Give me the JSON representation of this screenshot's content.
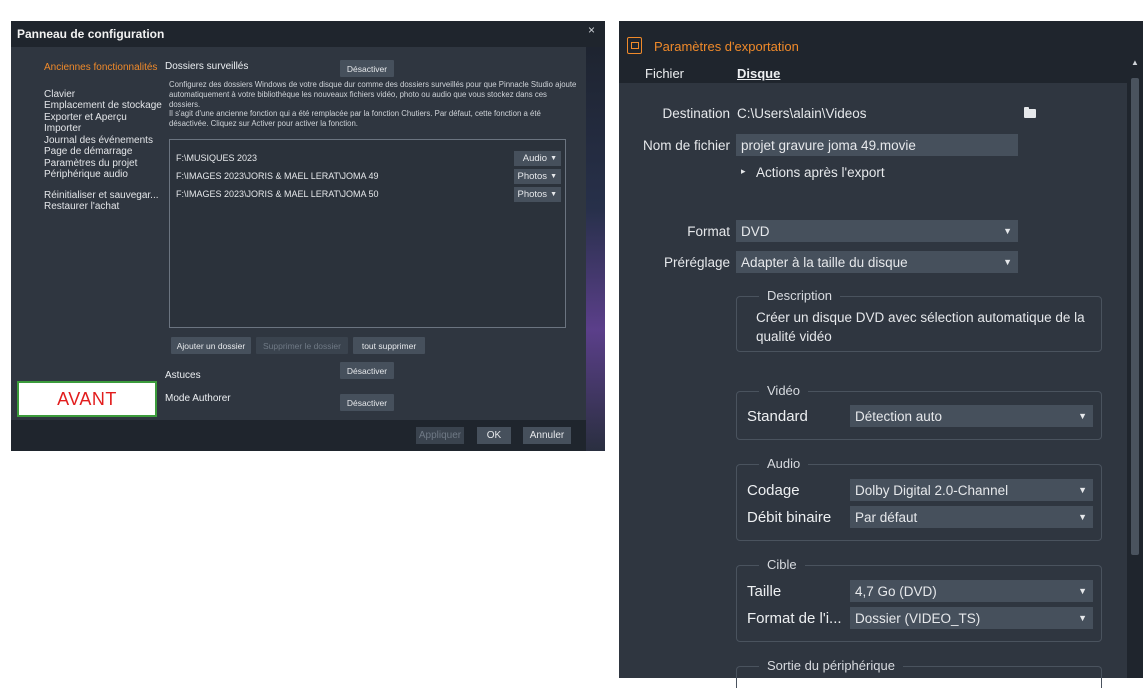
{
  "control_panel": {
    "title": "Panneau de configuration",
    "close_glyph": "×",
    "nav": {
      "active": "Anciennes fonctionnalités",
      "items": [
        "Clavier",
        "Emplacement de stockage",
        "Exporter et Aperçu",
        "Importer",
        "Journal des événements",
        "Page de démarrage",
        "Paramètres du projet",
        "Périphérique audio"
      ],
      "extra_items": [
        "Réinitialiser et sauvegar...",
        "Restaurer l'achat"
      ]
    },
    "watched_folders": {
      "title": "Dossiers surveillés",
      "toggle_label": "Désactiver",
      "desc1": "Configurez des dossiers Windows de votre disque dur comme des dossiers surveillés pour que Pinnacle Studio ajoute automatiquement à votre bibliothèque les nouveaux fichiers vidéo, photo ou audio que vous stockez dans ces dossiers.",
      "desc2": "Il s'agit d'une ancienne fonction qui a été remplacée par la fonction Chutiers. Par défaut, cette fonction a été désactivée. Cliquez sur Activer pour activer la fonction.",
      "folders": [
        {
          "path": "F:\\MUSIQUES 2023",
          "type": "Audio"
        },
        {
          "path": "F:\\IMAGES 2023\\JORIS & MAEL LERAT\\JOMA 49",
          "type": "Photos"
        },
        {
          "path": "F:\\IMAGES 2023\\JORIS & MAEL LERAT\\JOMA 50",
          "type": "Photos"
        }
      ],
      "add_label": "Ajouter un dossier",
      "remove_label": "Supprimer le dossier",
      "remove_all_label": "tout supprimer"
    },
    "tips": {
      "title": "Astuces",
      "toggle_label": "Désactiver"
    },
    "authoring": {
      "title": "Mode Authorer",
      "toggle_label": "Désactiver"
    },
    "footer": {
      "apply": "Appliquer",
      "ok": "OK",
      "cancel": "Annuler"
    },
    "overlay_label": "AVANT"
  },
  "export": {
    "title": "Paramètres d'exportation",
    "tabs": [
      "Fichier",
      "Disque"
    ],
    "active_tab": "Disque",
    "destination_label": "Destination",
    "destination_value": "C:\\Users\\alain\\Videos",
    "filename_label": "Nom de fichier",
    "filename_value": "projet gravure joma 49.movie",
    "after_export": "Actions après l'export",
    "format_label": "Format",
    "format_value": "DVD",
    "preset_label": "Préréglage",
    "preset_value": "Adapter à la taille du disque",
    "description_legend": "Description",
    "description_text": "Créer un disque DVD avec sélection automatique de la qualité vidéo",
    "video": {
      "legend": "Vidéo",
      "standard_label": "Standard",
      "standard_value": "Détection auto"
    },
    "audio": {
      "legend": "Audio",
      "codec_label": "Codage",
      "codec_value": "Dolby Digital 2.0-Channel",
      "bitrate_label": "Débit binaire",
      "bitrate_value": "Par défaut"
    },
    "target": {
      "legend": "Cible",
      "size_label": "Taille",
      "size_value": "4,7 Go (DVD)",
      "image_label": "Format de l'i...",
      "image_value": "Dossier (VIDEO_TS)"
    },
    "device_output_legend": "Sortie du périphérique",
    "arrow_glyph": "▼",
    "expand_glyph": "▸",
    "scroll_up_glyph": "▲"
  },
  "colors": {
    "accent": "#f08a2a",
    "panel": "#2f3640",
    "field": "#46505c",
    "avant_text": "#e21d1d",
    "avant_border": "#3c9b3c"
  }
}
